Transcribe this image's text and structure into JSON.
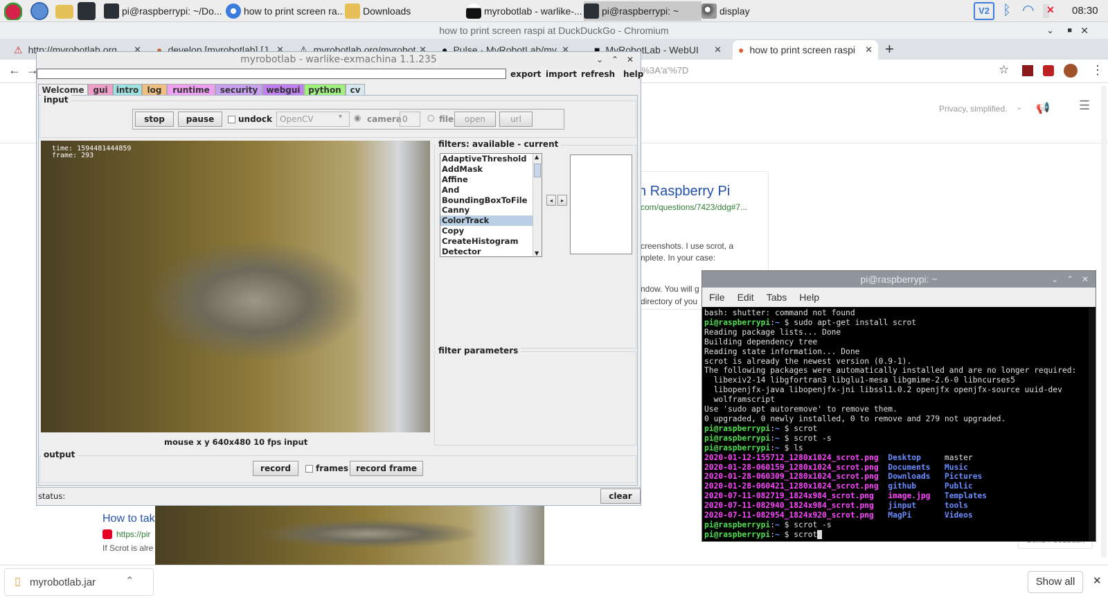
{
  "taskbar": {
    "tasks": [
      "pi@raspberrypi: ~/Do...",
      "how to print screen ra...",
      "Downloads",
      "myrobotlab - warlike-...",
      "pi@raspberrypi: ~",
      "display"
    ],
    "clock": "08:30"
  },
  "browser": {
    "window_title": "how to print screen raspi at DuckDuckGo - Chromium",
    "tabs": [
      "http://myrobotlab.org",
      "develop [myrobotlab] [J...",
      "myrobotlab.org/myrobot...",
      "Pulse · MyRobotLab/my...",
      "MyRobotLab - WebUI",
      "how to print screen raspi"
    ],
    "url_fragment": "'%3A'a'%7D",
    "privacy_text": "Privacy, simplified.",
    "result_title": "n Raspberry Pi",
    "result_url": "com/questions/7423/ddg#7...",
    "snippet_1": "creenshots. I use scrot, a",
    "snippet_2": "nplete. In your case:",
    "snippet_3": "ndow. You will g",
    "snippet_4": "directory of you",
    "result2_title": "How to tak",
    "result2_url": "https://pir",
    "result2_snippet": "If Scrot is alre",
    "send_feedback": "Send Feedback",
    "download_file": "myrobotlab.jar",
    "show_all": "Show all"
  },
  "mrl": {
    "title": "myrobotlab - warlike-exmachina 1.1.235",
    "menu": [
      "export",
      "import",
      "refresh",
      "help"
    ],
    "tabs": [
      {
        "label": "Welcome",
        "color": "#eeeeee"
      },
      {
        "label": "gui",
        "color": "#f0a0c8"
      },
      {
        "label": "intro",
        "color": "#a0e0e0"
      },
      {
        "label": "log",
        "color": "#f0c080"
      },
      {
        "label": "runtime",
        "color": "#f0a0f0"
      },
      {
        "label": "security",
        "color": "#c8a0f0"
      },
      {
        "label": "webgui",
        "color": "#c080f0"
      },
      {
        "label": "python",
        "color": "#a0f080"
      },
      {
        "label": "cv",
        "color": "#d8e8f0"
      }
    ],
    "input_label": "input",
    "stop": "stop",
    "pause": "pause",
    "undock": "undock",
    "grabber": "OpenCV",
    "camera": "camera",
    "camera_index": "0",
    "file": "file",
    "open": "open",
    "url": "url",
    "overlay_time": "time: 1594481444859",
    "overlay_frame": "frame: 293",
    "video_status": "mouse x y 640x480 10 fps input",
    "filters_label": "filters: available - current",
    "filters": [
      "AdaptiveThreshold",
      "AddMask",
      "Affine",
      "And",
      "BoundingBoxToFile",
      "Canny",
      "ColorTrack",
      "Copy",
      "CreateHistogram",
      "Detector"
    ],
    "selected_filter": "ColorTrack",
    "filter_params_label": "filter parameters",
    "output_label": "output",
    "record": "record",
    "frames": "frames",
    "record_frame": "record frame",
    "status": "status:",
    "clear": "clear"
  },
  "terminal": {
    "title": "pi@raspberrypi: ~",
    "menu": [
      "File",
      "Edit",
      "Tabs",
      "Help"
    ],
    "prompt": "pi@raspberrypi",
    "lines": [
      {
        "t": "plain",
        "text": "bash: shutter: command not found"
      },
      {
        "t": "cmd",
        "text": "sudo apt-get install scrot"
      },
      {
        "t": "plain",
        "text": "Reading package lists... Done"
      },
      {
        "t": "plain",
        "text": "Building dependency tree"
      },
      {
        "t": "plain",
        "text": "Reading state information... Done"
      },
      {
        "t": "plain",
        "text": "scrot is already the newest version (0.9-1)."
      },
      {
        "t": "plain",
        "text": "The following packages were automatically installed and are no longer required:"
      },
      {
        "t": "plain",
        "text": "  libexiv2-14 libgfortran3 libglu1-mesa libgmime-2.6-0 libncurses5"
      },
      {
        "t": "plain",
        "text": "  libopenjfx-java libopenjfx-jni libssl1.0.2 openjfx openjfx-source uuid-dev"
      },
      {
        "t": "plain",
        "text": "  wolframscript"
      },
      {
        "t": "plain",
        "text": "Use 'sudo apt autoremove' to remove them."
      },
      {
        "t": "plain",
        "text": "0 upgraded, 0 newly installed, 0 to remove and 279 not upgraded."
      },
      {
        "t": "cmd",
        "text": "scrot"
      },
      {
        "t": "cmd",
        "text": "scrot -s"
      },
      {
        "t": "cmd",
        "text": "ls"
      },
      {
        "t": "ls",
        "a": "2020-01-12-155712_1280x1024_scrot.png",
        "b": "Desktop",
        "c": "master",
        "bt": "tb",
        "ct": "plain"
      },
      {
        "t": "ls",
        "a": "2020-01-28-060159_1280x1024_scrot.png",
        "b": "Documents",
        "c": "Music",
        "bt": "tb",
        "ct": "tb"
      },
      {
        "t": "ls",
        "a": "2020-01-28-060309_1280x1024_scrot.png",
        "b": "Downloads",
        "c": "Pictures",
        "bt": "tb",
        "ct": "tb"
      },
      {
        "t": "ls",
        "a": "2020-01-28-060421_1280x1024_scrot.png",
        "b": "github",
        "c": "Public",
        "bt": "tb",
        "ct": "tb"
      },
      {
        "t": "ls",
        "a": "2020-07-11-082719_1824x984_scrot.png",
        "b": "image.jpg",
        "c": "Templates",
        "bt": "tm",
        "ct": "tb"
      },
      {
        "t": "ls",
        "a": "2020-07-11-082940_1824x984_scrot.png",
        "b": "jinput",
        "c": "tools",
        "bt": "tb",
        "ct": "tb"
      },
      {
        "t": "ls",
        "a": "2020-07-11-082954_1824x920_scrot.png",
        "b": "MagPi",
        "c": "Videos",
        "bt": "tb",
        "ct": "tb"
      },
      {
        "t": "cmd",
        "text": "scrot -s"
      },
      {
        "t": "cmd",
        "text": "scrot",
        "cursor": true
      }
    ]
  }
}
